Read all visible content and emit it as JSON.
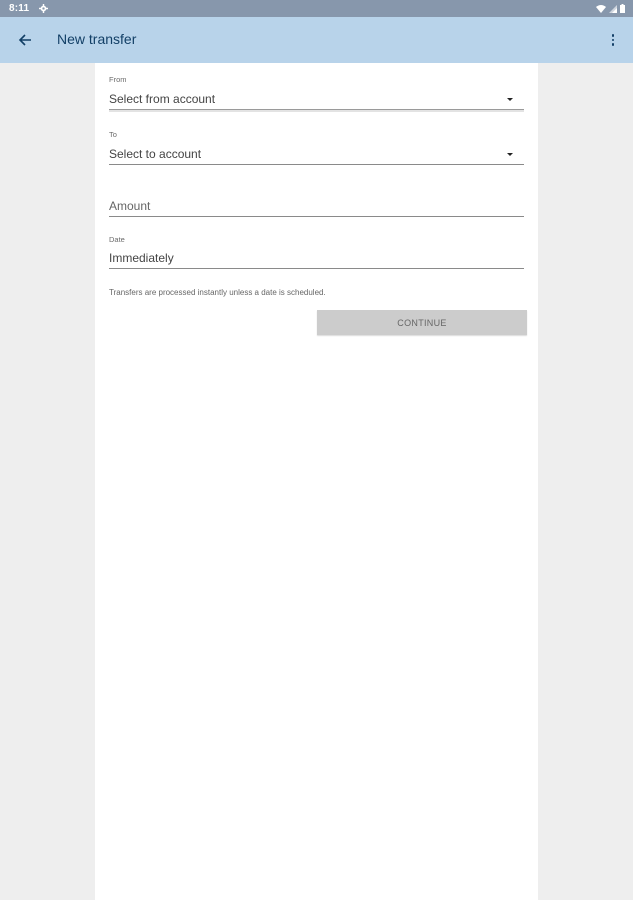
{
  "status_bar": {
    "time": "8:11",
    "icons": [
      "settings-icon",
      "wifi-icon",
      "signal-icon",
      "battery-icon"
    ]
  },
  "app_bar": {
    "title": "New transfer",
    "back_icon": "arrow-left-icon",
    "menu_icon": "more-vert-icon",
    "background": "#b8d3ea"
  },
  "form": {
    "from": {
      "label": "From",
      "value": "Select from account"
    },
    "to": {
      "label": "To",
      "value": "Select to account"
    },
    "amount": {
      "placeholder": "Amount"
    },
    "date": {
      "label": "Date",
      "value": "Immediately"
    },
    "helper_text": "Transfers are processed instantly unless a date is scheduled.",
    "continue_label": "CONTINUE"
  }
}
